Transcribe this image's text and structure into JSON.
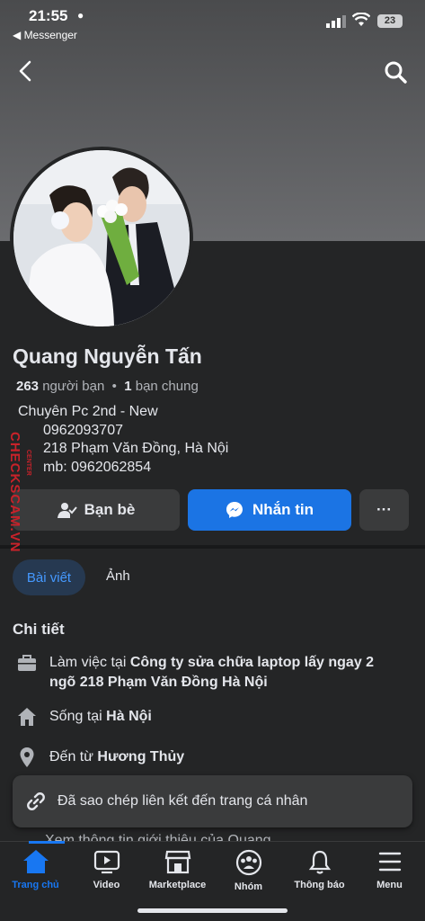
{
  "status_bar": {
    "time": "21:55",
    "back_app": "◀ Messenger",
    "battery": "23"
  },
  "profile": {
    "name": "Quang Nguyễn Tấn",
    "friends_count": "263",
    "friends_label": "người bạn",
    "mutual_count": "1",
    "mutual_label": "bạn chung",
    "bio": [
      "Chuyên Pc 2nd - New",
      "0962093707",
      "218 Phạm Văn Đồng, Hà Nội",
      "mb: 0962062854"
    ]
  },
  "actions": {
    "friends": "Bạn bè",
    "message": "Nhắn tin",
    "more": "···"
  },
  "tabs": {
    "posts": "Bài viết",
    "photos": "Ảnh"
  },
  "details": {
    "title": "Chi tiết",
    "work_prefix": "Làm việc tại",
    "work_place": "Công ty sửa chữa laptop lấy ngay 2",
    "work_place_2": "ngõ 218 Phạm Văn Đồng Hà Nội",
    "lives_prefix": "Sống tại",
    "lives_place": "Hà Nội",
    "from_prefix": "Đến từ",
    "from_place": "Hương Thủy",
    "see_intro": "Xem thông tin giới thiệu của Quang"
  },
  "toast": "Đã sao chép liên kết đến trang cá nhân",
  "bottom_nav": [
    "Trang chủ",
    "Video",
    "Marketplace",
    "Nhóm",
    "Thông báo",
    "Menu"
  ],
  "watermark": {
    "main": "CHECKSCAM.VN",
    "sub": "CENTER"
  },
  "colors": {
    "accent": "#1877f2",
    "background": "#242526",
    "surface": "#3a3b3c"
  }
}
